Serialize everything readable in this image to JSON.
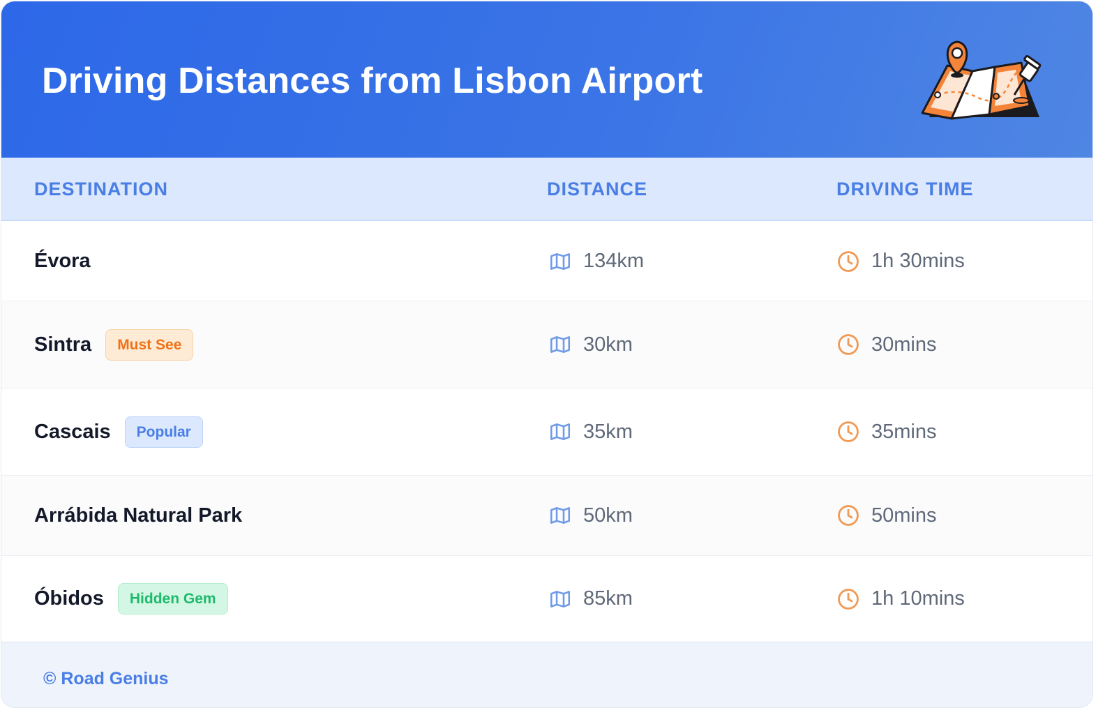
{
  "header": {
    "title": "Driving Distances from Lisbon Airport"
  },
  "table": {
    "columns": [
      "DESTINATION",
      "DISTANCE",
      "DRIVING TIME"
    ],
    "rows": [
      {
        "destination": "Évora",
        "badge": null,
        "distance": "134km",
        "driving_time": "1h 30mins"
      },
      {
        "destination": "Sintra",
        "badge": "Must See",
        "distance": "30km",
        "driving_time": "30mins"
      },
      {
        "destination": "Cascais",
        "badge": "Popular",
        "distance": "35km",
        "driving_time": "35mins"
      },
      {
        "destination": "Arrábida Natural Park",
        "badge": null,
        "distance": "50km",
        "driving_time": "50mins"
      },
      {
        "destination": "Óbidos",
        "badge": "Hidden Gem",
        "distance": "85km",
        "driving_time": "1h 10mins"
      }
    ]
  },
  "icons": {
    "header": "folded-map-with-pins-icon",
    "distance": "map-icon",
    "time": "clock-icon"
  },
  "footer": {
    "text": "© Road Genius"
  },
  "colors": {
    "header_blue": "#2d68e8",
    "accent_blue": "#4a7ee5",
    "accent_orange": "#f07216",
    "accent_green": "#1fb96c",
    "map_icon": "#6f9be8",
    "clock_icon": "#f09a55"
  }
}
